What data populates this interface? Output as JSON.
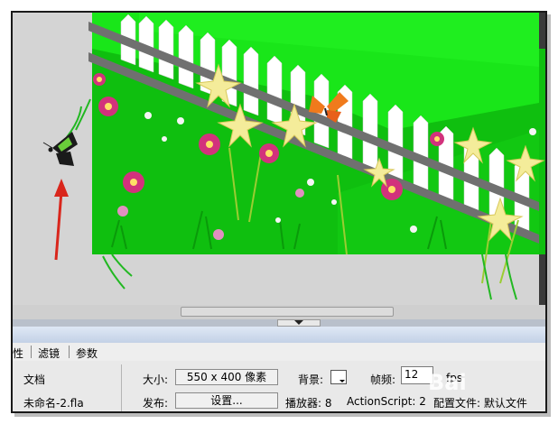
{
  "tabs": [
    {
      "label": "性"
    },
    {
      "label": "滤镜"
    },
    {
      "label": "参数"
    }
  ],
  "properties": {
    "doc_label": "文档",
    "filename": "未命名-2.fla",
    "size_label": "大小:",
    "size_value": "550 x 400 像素",
    "publish_label": "发布:",
    "settings_button": "设置...",
    "bg_label": "背景:",
    "fps_label": "帧频:",
    "fps_value": "12",
    "fps_unit": "fps",
    "player_text": "播放器: 8",
    "actionscript_text": "ActionScript: 2",
    "profile_text": "配置文件: 默认文件"
  },
  "watermark": "Bai",
  "colors": {
    "stage_bg": "#d4d4d4",
    "grass": "#0fbf0f",
    "bright_green": "#19e619",
    "fence": "#ffffff",
    "rail": "#707070",
    "arrow": "#d9261c",
    "panel_bg": "#e9e9e9",
    "tab_bar": "#c3d1e6"
  },
  "icons": {
    "butterfly_black": "butterfly-icon",
    "butterfly_orange": "butterfly-icon",
    "red_arrow": "arrow-up-icon",
    "bg_color_swatch": "color-swatch-icon"
  }
}
